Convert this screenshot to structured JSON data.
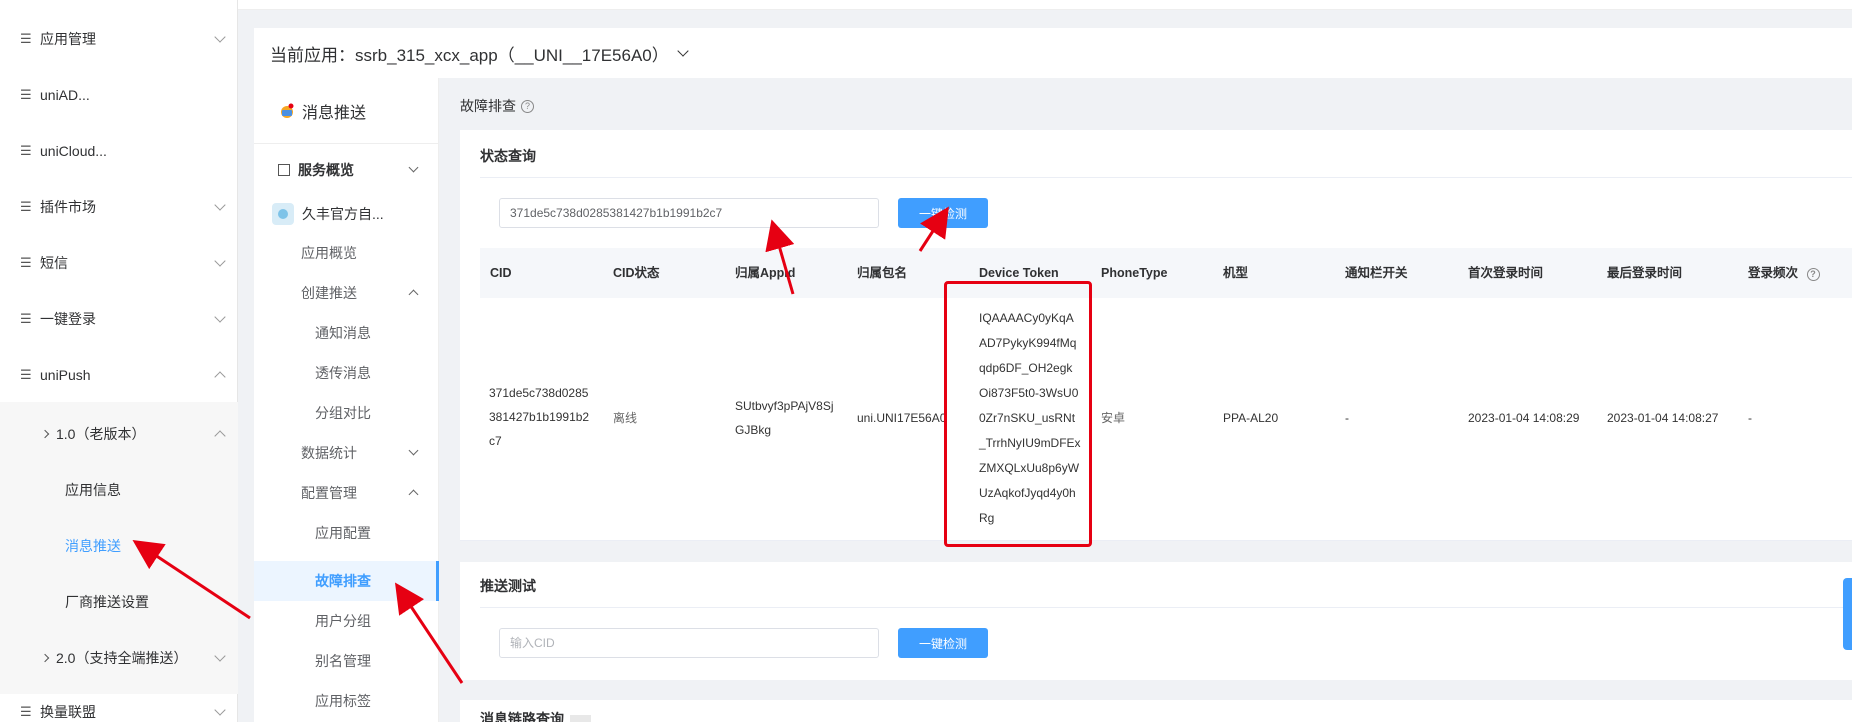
{
  "sidebar": {
    "items": [
      {
        "label": "应用管理",
        "expanded": false
      },
      {
        "label": "uniAD...",
        "expanded": null
      },
      {
        "label": "uniCloud...",
        "expanded": null
      },
      {
        "label": "插件市场",
        "expanded": false
      },
      {
        "label": "短信",
        "expanded": false
      },
      {
        "label": "一键登录",
        "expanded": false
      },
      {
        "label": "uniPush",
        "expanded": true
      }
    ],
    "unipush_children": [
      {
        "label": "1.0（老版本）"
      },
      {
        "label": "应用信息"
      },
      {
        "label": "消息推送",
        "active": true
      },
      {
        "label": "厂商推送设置"
      },
      {
        "label": "2.0（支持全端推送）"
      }
    ],
    "bottom_item": {
      "label": "换量联盟"
    }
  },
  "header": {
    "current_app": "当前应用：ssrb_315_xcx_app（__UNI__17E56A0）"
  },
  "nav2": {
    "title": "消息推送",
    "items": [
      {
        "label": "服务概览"
      },
      {
        "label": "久丰官方自..."
      },
      {
        "label": "应用概览"
      },
      {
        "label": "创建推送"
      },
      {
        "label": "通知消息"
      },
      {
        "label": "透传消息"
      },
      {
        "label": "分组对比"
      },
      {
        "label": "数据统计"
      },
      {
        "label": "配置管理"
      },
      {
        "label": "应用配置"
      },
      {
        "label": "故障排查",
        "active": true
      },
      {
        "label": "用户分组"
      },
      {
        "label": "别名管理"
      },
      {
        "label": "应用标签"
      }
    ]
  },
  "content": {
    "page_title": "故障排查",
    "status_query": {
      "title": "状态查询",
      "input_value": "371de5c738d0285381427b1b1991b2c7",
      "button": "一键检测",
      "columns": [
        "CID",
        "CID状态",
        "归属AppId",
        "归属包名",
        "Device Token",
        "PhoneType",
        "机型",
        "通知栏开关",
        "首次登录时间",
        "最后登录时间",
        "登录频次"
      ],
      "row": {
        "cid_lines": [
          "371de5c738d0285",
          "381427b1b1991b2",
          "c7"
        ],
        "cid_status": "离线",
        "appid_lines": [
          "SUtbvyf3pPAjV8Sj",
          "GJBkg"
        ],
        "package": "uni.UNI17E56A0",
        "device_token_lines": [
          "IQAAAACy0yKqA",
          "AD7PykyK994fMq",
          "qdp6DF_OH2egk",
          "Oi873F5t0-3WsU0",
          "0Zr7nSKU_usRNt",
          "_TrrhNyIU9mDFEx",
          "ZMXQLxUu8p6yW",
          "UzAqkofJyqd4y0h",
          "Rg"
        ],
        "phone_type": "安卓",
        "model": "PPA-AL20",
        "notify_switch": "-",
        "first_login": "2023-01-04 14:08:29",
        "last_login": "2023-01-04 14:08:27",
        "login_freq": "-"
      }
    },
    "push_test": {
      "title": "推送测试",
      "placeholder": "输入CID",
      "button": "一键检测"
    },
    "bottom_card": {
      "title_partial": "消息链路查询"
    }
  },
  "colors": {
    "accent": "#409eff",
    "annotation_red": "#e60012"
  }
}
